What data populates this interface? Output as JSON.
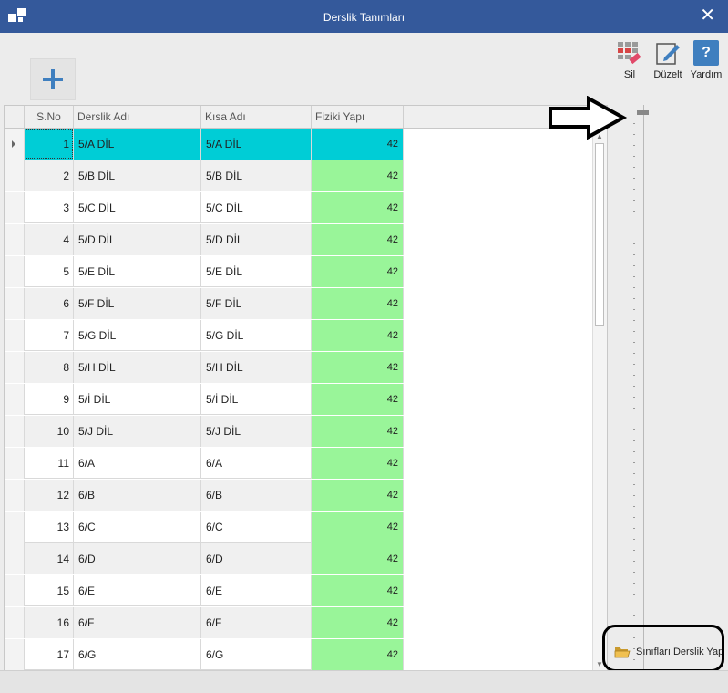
{
  "window": {
    "title": "Derslik Tanımları",
    "close_glyph": "✕"
  },
  "toolbar": {
    "add_icon": "plus-icon",
    "delete_label": "Sil",
    "edit_label": "Düzelt",
    "help_label": "Yardım",
    "help_glyph": "?"
  },
  "grid": {
    "columns": [
      "S.No",
      "Derslik Adı",
      "Kısa Adı",
      "Fiziki Yapı"
    ],
    "rows": [
      {
        "no": "1",
        "name": "5/A DİL",
        "short": "5/A DİL",
        "fiziki": "42"
      },
      {
        "no": "2",
        "name": "5/B DİL",
        "short": "5/B DİL",
        "fiziki": "42"
      },
      {
        "no": "3",
        "name": "5/C DİL",
        "short": "5/C DİL",
        "fiziki": "42"
      },
      {
        "no": "4",
        "name": "5/D DİL",
        "short": "5/D DİL",
        "fiziki": "42"
      },
      {
        "no": "5",
        "name": "5/E DİL",
        "short": "5/E DİL",
        "fiziki": "42"
      },
      {
        "no": "6",
        "name": "5/F DİL",
        "short": "5/F DİL",
        "fiziki": "42"
      },
      {
        "no": "7",
        "name": "5/G DİL",
        "short": "5/G DİL",
        "fiziki": "42"
      },
      {
        "no": "8",
        "name": "5/H DİL",
        "short": "5/H DİL",
        "fiziki": "42"
      },
      {
        "no": "9",
        "name": "5/İ DİL",
        "short": "5/İ DİL",
        "fiziki": "42"
      },
      {
        "no": "10",
        "name": "5/J DİL",
        "short": "5/J DİL",
        "fiziki": "42"
      },
      {
        "no": "11",
        "name": "6/A",
        "short": "6/A",
        "fiziki": "42"
      },
      {
        "no": "12",
        "name": "6/B",
        "short": "6/B",
        "fiziki": "42"
      },
      {
        "no": "13",
        "name": "6/C",
        "short": "6/C",
        "fiziki": "42"
      },
      {
        "no": "14",
        "name": "6/D",
        "short": "6/D",
        "fiziki": "42"
      },
      {
        "no": "15",
        "name": "6/E",
        "short": "6/E",
        "fiziki": "42"
      },
      {
        "no": "16",
        "name": "6/F",
        "short": "6/F",
        "fiziki": "42"
      },
      {
        "no": "17",
        "name": "6/G",
        "short": "6/G",
        "fiziki": "42"
      }
    ],
    "selected_row": 0
  },
  "bottom_button": {
    "label": "Sınıfları Derslik Yap",
    "icon": "folder-open-icon"
  },
  "colors": {
    "titlebar": "#34599b",
    "selected": "#00cdd6",
    "fiziki": "#99f599"
  }
}
